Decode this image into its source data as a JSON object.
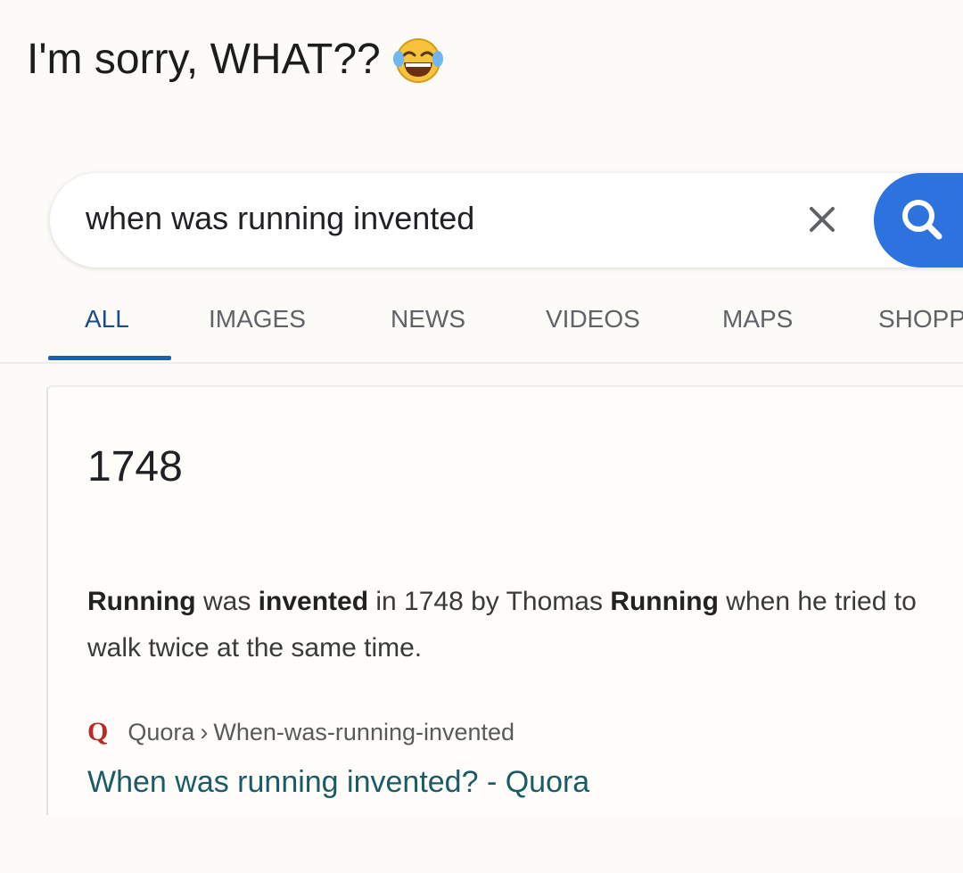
{
  "caption": {
    "text": "I'm sorry, WHAT??",
    "emoji_icon": "face-with-tears-of-joy-icon"
  },
  "search": {
    "query": "when was running invented",
    "clear_icon": "close-icon",
    "search_icon": "search-icon",
    "accent_color": "#2d73e0"
  },
  "tabs": [
    {
      "label": "ALL",
      "active": true
    },
    {
      "label": "IMAGES",
      "active": false
    },
    {
      "label": "NEWS",
      "active": false
    },
    {
      "label": "VIDEOS",
      "active": false
    },
    {
      "label": "MAPS",
      "active": false
    },
    {
      "label": "SHOPP",
      "active": false
    }
  ],
  "result": {
    "answer": "1748",
    "snippet": {
      "w1": "Running",
      "t1": " was ",
      "w2": "invented",
      "t2": " in 1748 by Thomas ",
      "w3": "Running",
      "t3": " when he tried to walk twice at the same time."
    },
    "source": {
      "icon": "quora-logo-icon",
      "site": "Quora",
      "separator": "›",
      "path": "When-was-running-invented"
    },
    "link_title": "When was running invented? - Quora"
  }
}
